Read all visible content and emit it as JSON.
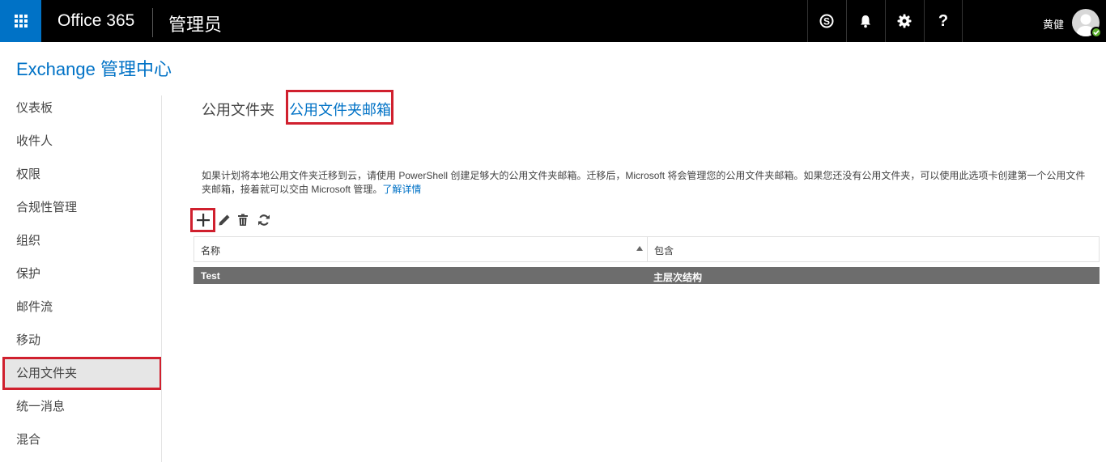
{
  "topbar": {
    "brand": "Office 365",
    "app_name": "管理员",
    "user_name": "黄健",
    "buttons": [
      "skype-icon",
      "bell-icon",
      "gear-icon",
      "help-icon"
    ],
    "help_label": "?"
  },
  "page": {
    "title": "Exchange 管理中心"
  },
  "sidebar": {
    "items": [
      {
        "label": "仪表板"
      },
      {
        "label": "收件人"
      },
      {
        "label": "权限"
      },
      {
        "label": "合规性管理"
      },
      {
        "label": "组织"
      },
      {
        "label": "保护"
      },
      {
        "label": "邮件流"
      },
      {
        "label": "移动"
      },
      {
        "label": "公用文件夹",
        "selected": true
      },
      {
        "label": "统一消息"
      },
      {
        "label": "混合"
      }
    ]
  },
  "main": {
    "tabs": [
      {
        "label": "公用文件夹"
      },
      {
        "label": "公用文件夹邮箱",
        "active": true
      }
    ],
    "description": "如果计划将本地公用文件夹迁移到云，请使用 PowerShell 创建足够大的公用文件夹邮箱。迁移后，Microsoft 将会管理您的公用文件夹邮箱。如果您还没有公用文件夹，可以使用此选项卡创建第一个公用文件夹邮箱，接着就可以交由 Microsoft 管理。",
    "learn_more": "了解详情",
    "toolbar": [
      "add-icon",
      "edit-icon",
      "delete-icon",
      "refresh-icon"
    ],
    "table": {
      "columns": [
        "名称",
        "包含"
      ],
      "sort": "ascending",
      "rows": [
        {
          "name": "Test",
          "contains": "主层次结构",
          "selected": true
        }
      ]
    }
  },
  "colors": {
    "accent": "#0072c6",
    "highlight_box": "#d0202e",
    "selected_row": "#6d6d6d",
    "presence": "#5db12f"
  }
}
